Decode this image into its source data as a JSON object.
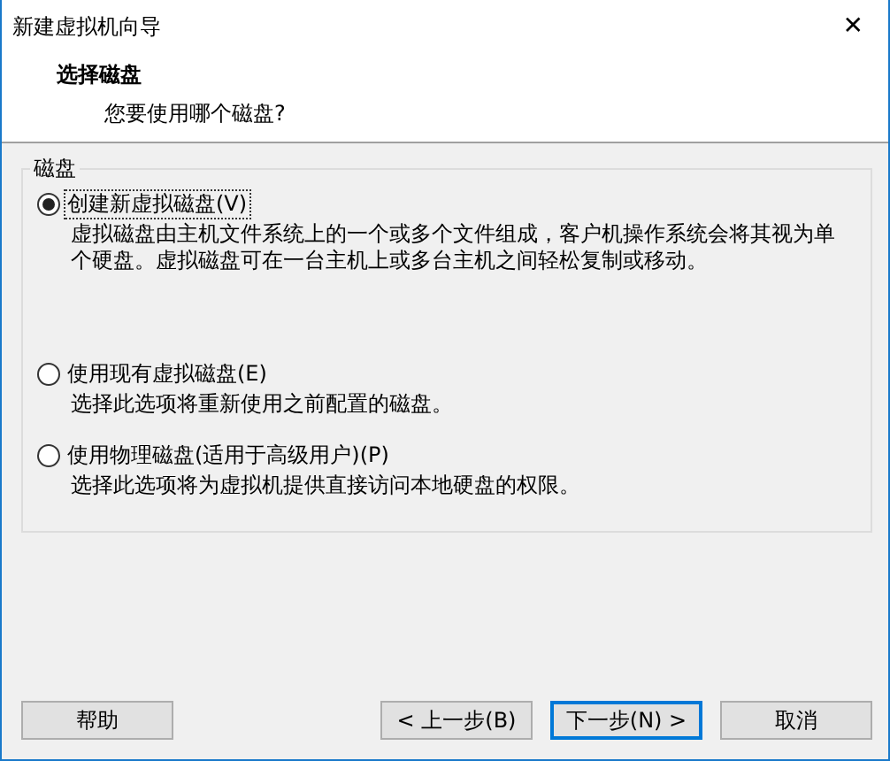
{
  "window": {
    "title": "新建虚拟机向导",
    "close": "✕"
  },
  "header": {
    "title": "选择磁盘",
    "subtitle": "您要使用哪个磁盘?"
  },
  "group": {
    "label": "磁盘",
    "options": [
      {
        "label": "创建新虚拟磁盘(V)",
        "selected": true,
        "description": "虚拟磁盘由主机文件系统上的一个或多个文件组成，客户机操作系统会将其视为单个硬盘。虚拟磁盘可在一台主机上或多台主机之间轻松复制或移动。"
      },
      {
        "label": "使用现有虚拟磁盘(E)",
        "selected": false,
        "description": "选择此选项将重新使用之前配置的磁盘。"
      },
      {
        "label": "使用物理磁盘(适用于高级用户)(P)",
        "selected": false,
        "description": "选择此选项将为虚拟机提供直接访问本地硬盘的权限。"
      }
    ]
  },
  "buttons": {
    "help": "帮助",
    "back": "< 上一步(B)",
    "next": "下一步(N) >",
    "cancel": "取消"
  }
}
